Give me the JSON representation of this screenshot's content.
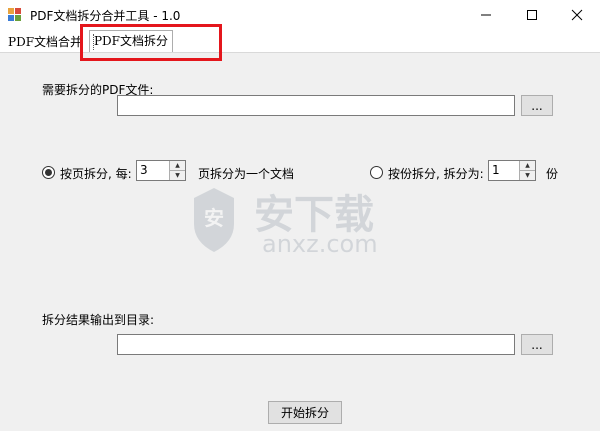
{
  "window": {
    "title": "PDF文档拆分合并工具 - 1.0",
    "controls": [
      "minimize-icon",
      "maximize-icon",
      "close-icon"
    ]
  },
  "tabs": [
    {
      "label": "PDF文档合并",
      "active": false
    },
    {
      "label": "PDF文档拆分",
      "active": true
    }
  ],
  "split": {
    "source_label": "需要拆分的PDF文件:",
    "source_value": "",
    "browse_label": "...",
    "mode_by_page_label": "按页拆分, 每:",
    "pages_per_doc": "3",
    "pages_suffix": "页拆分为一个文档",
    "mode_by_parts_label": "按份拆分, 拆分为:",
    "parts_count": "1",
    "parts_suffix": "份",
    "selected_mode": "by_page",
    "output_label": "拆分结果输出到目录:",
    "output_value": "",
    "output_browse_label": "...",
    "start_label": "开始拆分"
  },
  "watermark": {
    "brand_cn": "安下载",
    "brand_url": "anxz.com",
    "logo_glyph": "安"
  },
  "colors": {
    "highlight": "#e4161c",
    "panel": "#f0f0f0",
    "watermark": "#6b7b8c"
  }
}
